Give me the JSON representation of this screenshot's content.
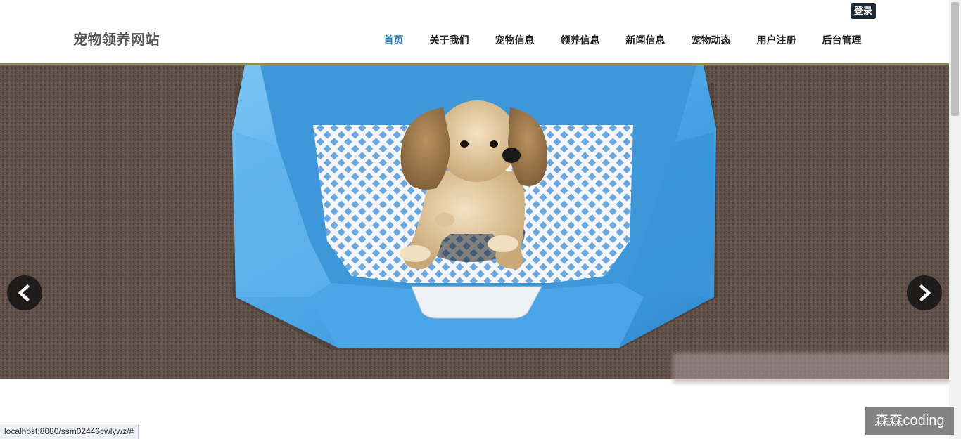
{
  "header": {
    "site_title": "宠物领养网站",
    "login_label": "登录"
  },
  "nav": {
    "items": [
      {
        "label": "首页",
        "active": true
      },
      {
        "label": "关于我们"
      },
      {
        "label": "宠物信息"
      },
      {
        "label": "领养信息"
      },
      {
        "label": "新闻信息"
      },
      {
        "label": "宠物动态"
      },
      {
        "label": "用户注册"
      },
      {
        "label": "后台管理"
      }
    ]
  },
  "slider": {
    "prev_icon": "chevron-left-icon",
    "next_icon": "chevron-right-icon",
    "image": "puppy-in-blue-pet-toilet"
  },
  "status_bar": {
    "url": "localhost:8080/ssm02446cwlywz/#"
  },
  "watermark": {
    "text": "森森coding"
  },
  "colors": {
    "nav_active": "#2b7fb1",
    "login_bg": "#1b2a35",
    "carpet": "#5e4f49",
    "tray_blue": "#4aa6e6"
  }
}
